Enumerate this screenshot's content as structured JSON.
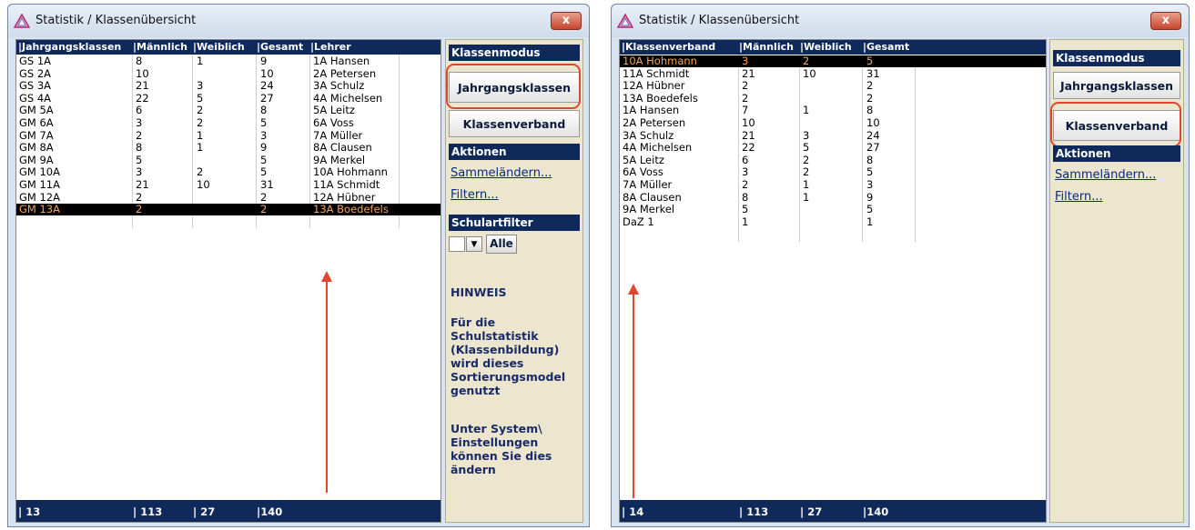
{
  "left_window": {
    "title": "Statistik / Klassenübersicht",
    "close_label": "x",
    "columns": [
      "|Jahrgangsklassen",
      "|Männlich",
      "|Weiblich",
      "|Gesamt",
      "|Lehrer"
    ],
    "rows": [
      [
        "GS 1A",
        "8",
        "1",
        "9",
        "1A Hansen"
      ],
      [
        "GS 2A",
        "10",
        "",
        "10",
        "2A Petersen"
      ],
      [
        "GS 3A",
        "21",
        "3",
        "24",
        "3A Schulz"
      ],
      [
        "GS 4A",
        "22",
        "5",
        "27",
        "4A Michelsen"
      ],
      [
        "GM 5A",
        "6",
        "2",
        "8",
        "5A Leitz"
      ],
      [
        "GM 6A",
        "3",
        "2",
        "5",
        "6A Voss"
      ],
      [
        "GM 7A",
        "2",
        "1",
        "3",
        "7A Müller"
      ],
      [
        "GM 8A",
        "8",
        "1",
        "9",
        "8A Clausen"
      ],
      [
        "GM 9A",
        "5",
        "",
        "5",
        "9A Merkel"
      ],
      [
        "GM 10A",
        "3",
        "2",
        "5",
        "10A Hohmann"
      ],
      [
        "GM 11A",
        "21",
        "10",
        "31",
        "11A Schmidt"
      ],
      [
        "GM 12A",
        "2",
        "",
        "2",
        "12A Hübner"
      ],
      [
        "GM 13A",
        "2",
        "",
        "2",
        "13A Boedefels"
      ]
    ],
    "selected_row": 12,
    "footer": [
      "| 13",
      "| 113",
      "| 27",
      "|140"
    ],
    "side": {
      "klassenmodus": "Klassenmodus",
      "btn_jahrgang": "Jahrgangsklassen",
      "btn_verband": "Klassenverband",
      "aktionen": "Aktionen",
      "link_sammel": "Sammeländern...",
      "link_filter": "Filtern...",
      "schulartfilter": "Schulartfilter",
      "btn_alle": "Alle",
      "hinweis_title": "HINWEIS",
      "hinweis_text1": "Für die Schulstatistik (Klassenbildung) wird dieses Sortierungsmodel genutzt",
      "hinweis_text2": "Unter System\\ Einstellungen können Sie dies ändern"
    }
  },
  "right_window": {
    "title": "Statistik / Klassenübersicht",
    "close_label": "x",
    "columns": [
      "|Klassenverband",
      "|Männlich",
      "|Weiblich",
      "|Gesamt"
    ],
    "rows": [
      [
        "10A Hohmann",
        "3",
        "2",
        "5"
      ],
      [
        "11A Schmidt",
        "21",
        "10",
        "31"
      ],
      [
        "12A Hübner",
        "2",
        "",
        "2"
      ],
      [
        "13A Boedefels",
        "2",
        "",
        "2"
      ],
      [
        "1A Hansen",
        "7",
        "1",
        "8"
      ],
      [
        "2A Petersen",
        "10",
        "",
        "10"
      ],
      [
        "3A Schulz",
        "21",
        "3",
        "24"
      ],
      [
        "4A Michelsen",
        "22",
        "5",
        "27"
      ],
      [
        "5A Leitz",
        "6",
        "2",
        "8"
      ],
      [
        "6A Voss",
        "3",
        "2",
        "5"
      ],
      [
        "7A Müller",
        "2",
        "1",
        "3"
      ],
      [
        "8A Clausen",
        "8",
        "1",
        "9"
      ],
      [
        "9A Merkel",
        "5",
        "",
        "5"
      ],
      [
        "DaZ 1",
        "1",
        "",
        "1"
      ]
    ],
    "selected_row": 0,
    "footer": [
      "| 14",
      "| 113",
      "| 27",
      "|140"
    ],
    "side": {
      "klassenmodus": "Klassenmodus",
      "btn_jahrgang": "Jahrgangsklassen",
      "btn_verband": "Klassenverband",
      "aktionen": "Aktionen",
      "link_sammel": "Sammeländern...",
      "link_filter": "Filtern..."
    }
  },
  "colors": {
    "header_bg": "#0f2a5a",
    "highlight": "#e0452e",
    "selected_text": "#f2a55d"
  },
  "icons": {
    "title_icon": "warning-triangle-icon",
    "close_icon": "close-icon",
    "dropdown_icon": "chevron-down-icon"
  }
}
